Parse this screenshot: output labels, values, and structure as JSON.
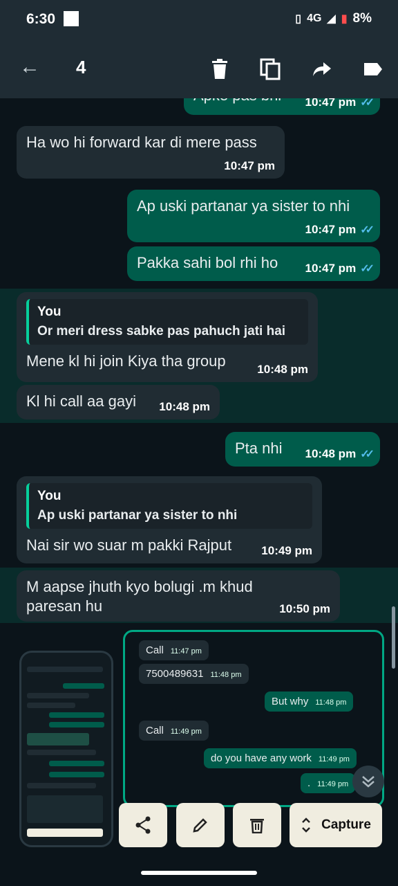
{
  "status": {
    "time": "6:30",
    "network": "4G",
    "battery": "8%"
  },
  "toolbar": {
    "selected_count": "4"
  },
  "messages": {
    "m0": {
      "text": "Apke pas bhi",
      "time": "10:47 pm"
    },
    "m1": {
      "text": "Ha wo hi forward kar di mere pass",
      "time": "10:47 pm"
    },
    "m2": {
      "text": "Ap uski partanar ya sister to nhi",
      "time": "10:47 pm"
    },
    "m3": {
      "text": "Pakka sahi bol rhi ho",
      "time": "10:47 pm"
    },
    "m4": {
      "quote_author": "You",
      "quote_text": "Or meri dress sabke pas pahuch jati hai",
      "text": "Mene kl hi join Kiya tha group",
      "time": "10:48 pm"
    },
    "m5": {
      "text": "Kl hi call aa gayi",
      "time": "10:48 pm"
    },
    "m6": {
      "text": "Pta nhi",
      "time": "10:48 pm"
    },
    "m7": {
      "quote_author": "You",
      "quote_text": "Ap uski partanar ya sister to nhi",
      "text": "Nai sir wo suar m pakki Rajput",
      "time": "10:49 pm"
    },
    "m8": {
      "text_line1": "M aapse jhuth kyo bolugi .m khud",
      "text_line2": "paresan hu",
      "time": "10:50 pm"
    }
  },
  "overlay": {
    "o1": {
      "text": "Call",
      "time": "11:47 pm"
    },
    "o2": {
      "text": "7500489631",
      "time": "11:48 pm"
    },
    "o3": {
      "text": "But why",
      "time": "11:48 pm"
    },
    "o4": {
      "text": "Call",
      "time": "11:49 pm"
    },
    "o5": {
      "text": "do you have any work",
      "time": "11:49 pm"
    },
    "o6": {
      "text": ".",
      "time": "11:49 pm"
    }
  },
  "actions": {
    "capture_label": "Capture"
  },
  "icons": {
    "back": "arrow-left-icon",
    "delete": "trash-icon",
    "copy": "copy-icon",
    "forward": "forward-arrow-icon",
    "label": "label-tag-icon",
    "share": "share-icon",
    "edit": "pencil-icon",
    "chevron": "chevron-double-down-icon"
  },
  "colors": {
    "accent": "#00a884",
    "outgoing": "#005c4b",
    "incoming": "#202c33",
    "read_ticks": "#53bdeb",
    "selection": "rgba(0,168,132,0.17)"
  }
}
